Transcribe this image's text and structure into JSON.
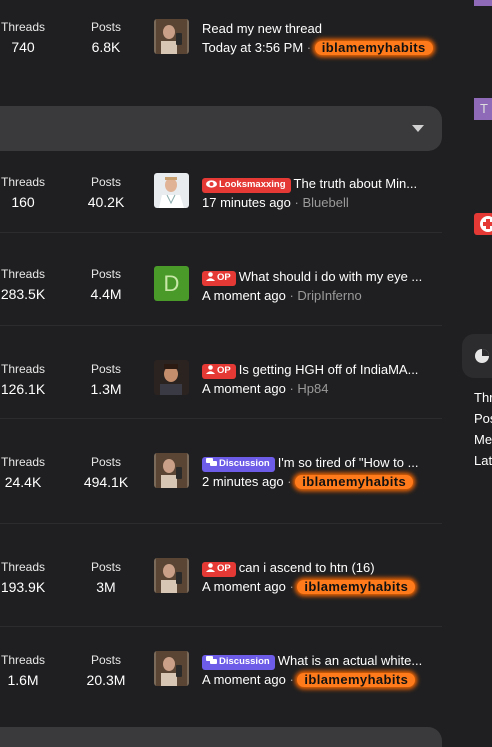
{
  "labels": {
    "threads": "Threads",
    "posts": "Posts"
  },
  "forums": [
    {
      "threads": "740",
      "posts": "6.8K",
      "badge": "",
      "title": "Read my new thread",
      "time": "Today at 3:56 PM",
      "user": "iblamemyhabits",
      "user_glow": true
    },
    {
      "threads": "160",
      "posts": "40.2K",
      "badge": "Looksmaxxing",
      "title": "The truth about Min...",
      "time": "17 minutes ago",
      "user": "Bluebell",
      "user_glow": false
    },
    {
      "threads": "283.5K",
      "posts": "4.4M",
      "badge": "OP",
      "title": "What should i do with my eye ...",
      "time": "A moment ago",
      "user": "DripInferno",
      "user_glow": false,
      "avatar_letter": "D"
    },
    {
      "threads": "126.1K",
      "posts": "1.3M",
      "badge": "OP",
      "title": "Is getting HGH off of IndiaMA...",
      "time": "A moment ago",
      "user": "Hp84",
      "user_glow": false
    },
    {
      "threads": "24.4K",
      "posts": "494.1K",
      "badge": "Discussion",
      "title": "I'm so tired of \"How to ...",
      "time": "2 minutes ago",
      "user": "iblamemyhabits",
      "user_glow": true
    },
    {
      "threads": "193.9K",
      "posts": "3M",
      "badge": "OP",
      "title": "can i ascend to htn (16)",
      "time": "A moment ago",
      "user": "iblamemyhabits",
      "user_glow": true
    },
    {
      "threads": "1.6M",
      "posts": "20.3M",
      "badge": "Discussion",
      "title": "What is an actual white...",
      "time": "A moment ago",
      "user": "iblamemyhabits",
      "user_glow": true
    }
  ],
  "sidebar": {
    "tag_letter": "T",
    "stats": [
      "Thr",
      "Pos",
      "Me",
      "Lat"
    ]
  },
  "colors": {
    "op_badge": "#e53935",
    "discussion_badge": "#6c5ce7",
    "glow": "#ff7a1a",
    "avatar_green": "#4a9a2a"
  },
  "icons": [
    "chevron-down-icon",
    "eye-icon",
    "user-icon",
    "chat-icon",
    "pie-chart-icon",
    "plus-icon"
  ]
}
